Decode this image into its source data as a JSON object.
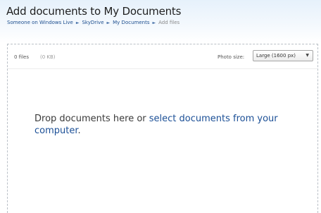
{
  "header": {
    "title": "Add documents to My Documents",
    "breadcrumb": [
      {
        "label": "Someone on Windows Live"
      },
      {
        "label": "SkyDrive"
      },
      {
        "label": "My Documents"
      },
      {
        "label": "Add files"
      }
    ],
    "separator": "►"
  },
  "toolbar": {
    "file_count": "0 files",
    "file_size": "(0 KB)",
    "photo_size_label": "Photo size:",
    "photo_size_value": "Large (1600 px)",
    "dropdown_arrow": "▼"
  },
  "drop_zone": {
    "text_before": "Drop documents here or ",
    "link_text": "select documents from your computer",
    "text_after": "."
  },
  "colors": {
    "link": "#1b4f96",
    "header_gradient_top": "#e6f1fb"
  }
}
